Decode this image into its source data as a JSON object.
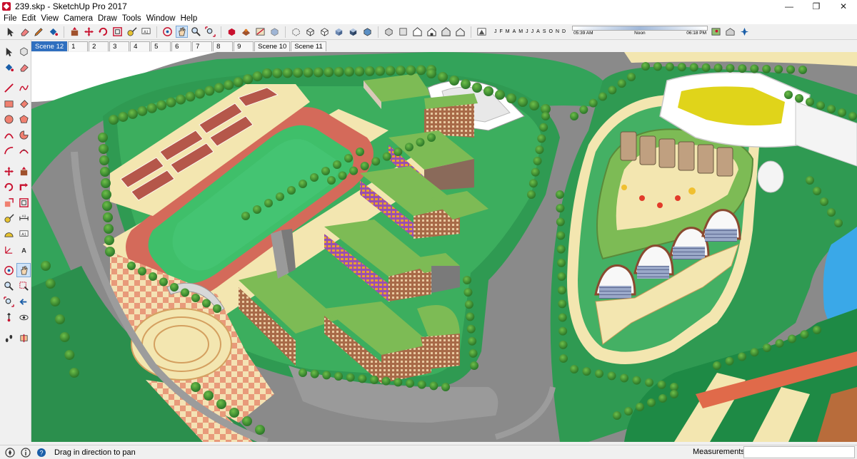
{
  "window": {
    "title": "239.skp - SketchUp Pro 2017",
    "minimize_glyph": "—",
    "maximize_glyph": "❐",
    "close_glyph": "✕"
  },
  "menu": [
    "File",
    "Edit",
    "View",
    "Camera",
    "Draw",
    "Tools",
    "Window",
    "Help"
  ],
  "toolbar": {
    "months": [
      "J",
      "F",
      "M",
      "A",
      "M",
      "J",
      "J",
      "A",
      "S",
      "O",
      "N",
      "D"
    ],
    "shadow_times": [
      "05:39 AM",
      "Noon",
      "06:18 PM"
    ],
    "icons": [
      "select-icon",
      "eraser-icon",
      "pencil-icon",
      "paint-bucket-icon",
      "push-pull-icon",
      "move-icon",
      "rotate-icon",
      "offset-icon",
      "tape-measure-icon",
      "text-icon",
      "orbit-icon",
      "pan-icon",
      "zoom-icon",
      "zoom-extents-icon",
      "components-icon",
      "materials-icon",
      "styles-icon",
      "xray-icon",
      "back-edges-icon",
      "wireframe-icon",
      "hidden-line-icon",
      "shaded-icon",
      "shaded-textures-icon",
      "monochrome-icon",
      "iso-view-icon",
      "top-view-icon",
      "front-view-icon",
      "right-view-icon",
      "back-view-icon",
      "left-view-icon",
      "shadows-toggle-icon",
      "geo-location-icon",
      "warehouse-icon",
      "extension-icon"
    ]
  },
  "scenes": {
    "active": "Scene 12",
    "tabs": [
      "Scene 12",
      "1",
      "2",
      "3",
      "4",
      "5",
      "6",
      "7",
      "8",
      "9",
      "Scene 10",
      "Scene 11"
    ]
  },
  "palette": {
    "icons": [
      "select-icon",
      "make-component-icon",
      "paint-bucket-icon",
      "eraser-icon",
      "line-icon",
      "freehand-icon",
      "rectangle-icon",
      "rotated-rectangle-icon",
      "circle-icon",
      "polygon-icon",
      "arc-icon",
      "pie-icon",
      "two-point-arc-icon",
      "three-point-arc-icon",
      "move-icon",
      "push-pull-icon",
      "rotate-icon",
      "follow-me-icon",
      "scale-icon",
      "offset-icon",
      "tape-measure-icon",
      "dimension-icon",
      "protractor-icon",
      "text-icon",
      "axes-icon",
      "3d-text-icon",
      "orbit-icon",
      "pan-icon",
      "zoom-icon",
      "zoom-window-icon",
      "zoom-extents-icon",
      "previous-view-icon",
      "position-camera-icon",
      "look-around-icon",
      "walk-icon",
      "section-plane-icon"
    ]
  },
  "status": {
    "message": "Drag in direction to pan",
    "measurements_label": "Measurements",
    "measurements_value": ""
  },
  "colors": {
    "road": "#808080",
    "lawn": "#33a35a",
    "dark_lawn": "#1e8a45",
    "roof": "#7dbb55",
    "brick": "#b07050",
    "track": "#d46a5a",
    "field": "#3fbf6a",
    "plaza": "#f3e6b0",
    "water": "#3aa8e8",
    "active_tab": "#2f6fbf"
  }
}
